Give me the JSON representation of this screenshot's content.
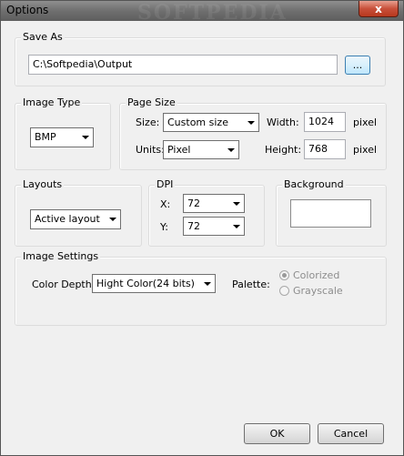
{
  "window": {
    "title": "Options",
    "watermark": "SOFTPEDIA",
    "close_glyph": "x"
  },
  "save_as": {
    "legend": "Save As",
    "path": "C:\\Softpedia\\Output",
    "browse_label": "..."
  },
  "image_type": {
    "legend": "Image Type",
    "value": "BMP"
  },
  "page_size": {
    "legend": "Page Size",
    "size_label": "Size:",
    "size_value": "Custom size",
    "units_label": "Units:",
    "units_value": "Pixel",
    "width_label": "Width:",
    "width_value": "1024",
    "width_unit": "pixel",
    "height_label": "Height:",
    "height_value": "768",
    "height_unit": "pixel"
  },
  "layouts": {
    "legend": "Layouts",
    "value": "Active layout"
  },
  "dpi": {
    "legend": "DPI",
    "x_label": "X:",
    "x_value": "72",
    "y_label": "Y:",
    "y_value": "72"
  },
  "background": {
    "legend": "Background",
    "color": "#ffffff"
  },
  "image_settings": {
    "legend": "Image Settings",
    "color_depth_label": "Color Depth:",
    "color_depth_value": "Hight Color(24 bits)",
    "palette_label": "Palette:",
    "colorized_label": "Colorized",
    "grayscale_label": "Grayscale",
    "selected_palette": "Colorized"
  },
  "buttons": {
    "ok": "OK",
    "cancel": "Cancel"
  },
  "colors": {
    "accent_border": "#3c7fb1",
    "close_red": "#c8503a",
    "disabled_text": "#8d8d8d"
  }
}
